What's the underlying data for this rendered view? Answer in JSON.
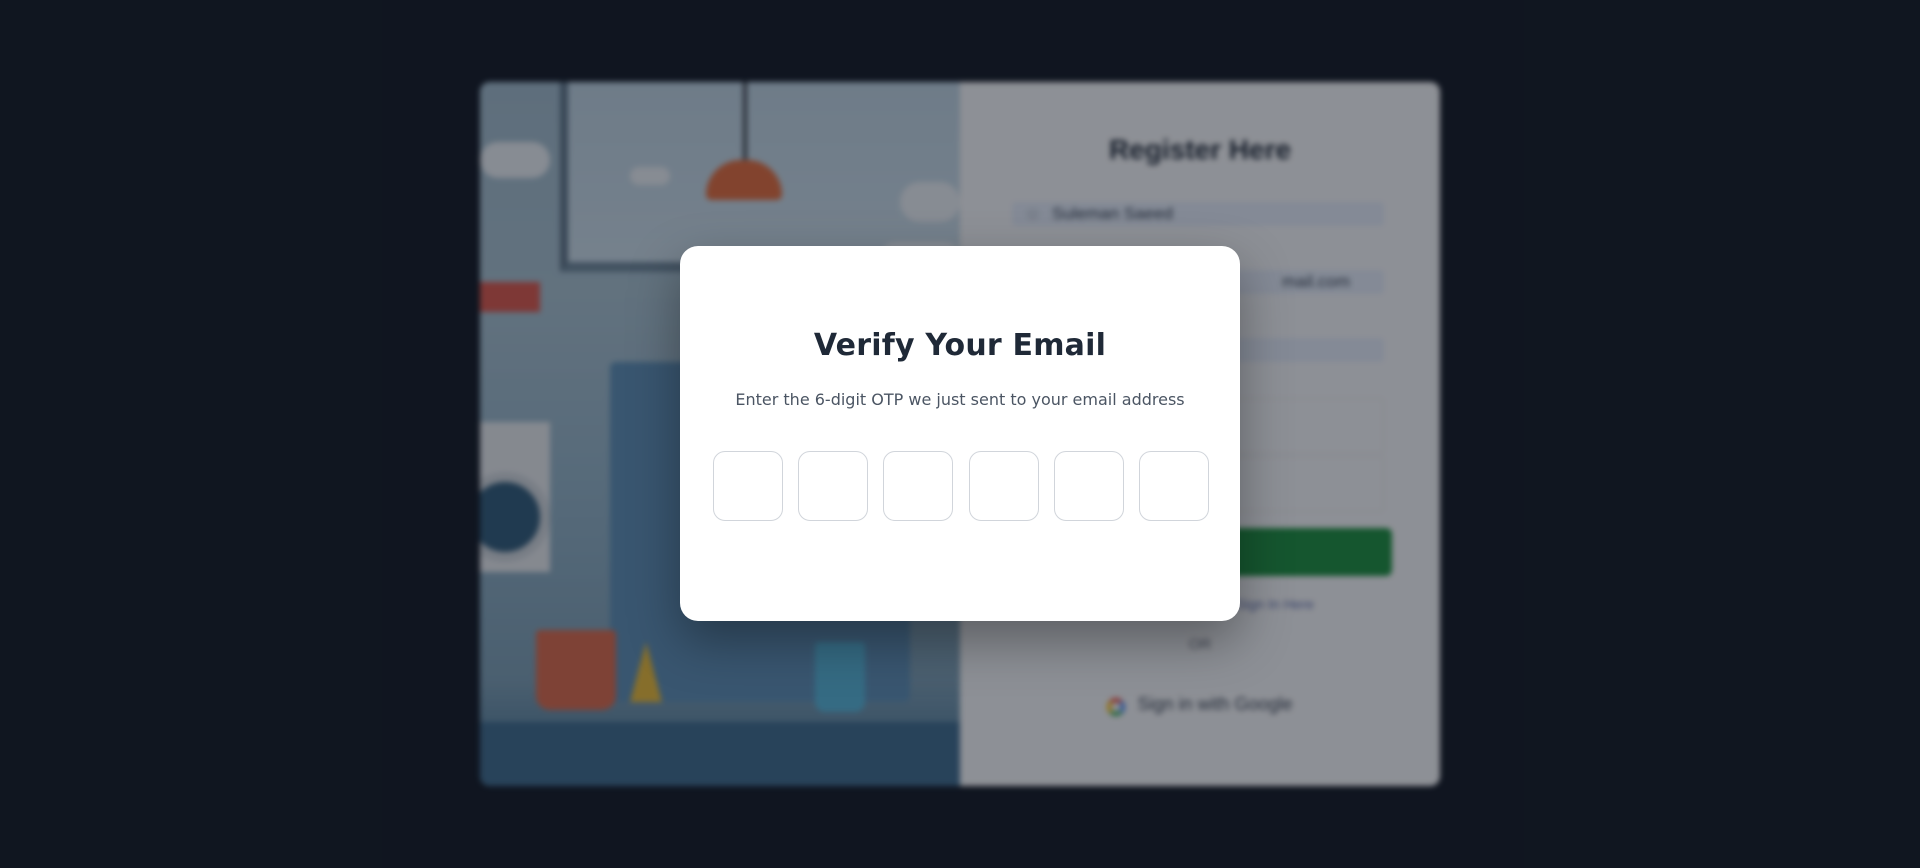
{
  "background": {
    "register_title": "Register Here",
    "name_value": "Suleman Saeed",
    "email_value_fragment": "mail.com",
    "signin_prompt": "Sign In Here",
    "or_text": "OR",
    "google_button_label": "Sign in with Google"
  },
  "modal": {
    "title": "Verify Your Email",
    "subtitle": "Enter the 6-digit OTP we just sent to your email address",
    "otp_digits": [
      "",
      "",
      "",
      "",
      "",
      ""
    ]
  },
  "colors": {
    "page_background": "#111722",
    "modal_background": "#ffffff",
    "title_color": "#1f2937",
    "primary_green": "#1a8c3c"
  }
}
